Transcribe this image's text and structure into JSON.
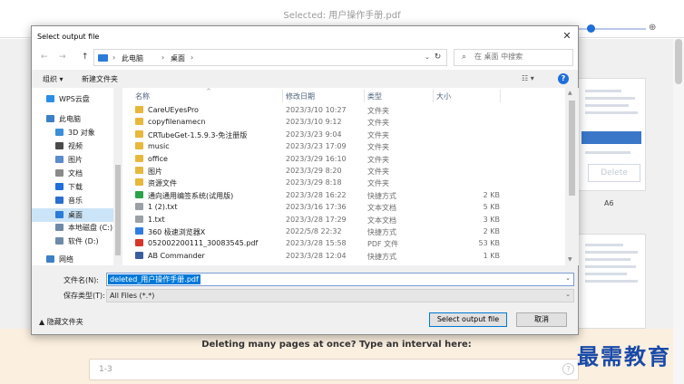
{
  "background": {
    "title": "Selected: 用户操作手册.pdf",
    "zoom_in_icon": "zoom-in-icon",
    "delete_label": "Delete",
    "page_label": "A6",
    "interval_prompt": "Deleting many pages at once? Type an interval here:",
    "interval_placeholder": "1-3",
    "help_glyph": "?",
    "watermark": "最需教育"
  },
  "dialog": {
    "title": "Select output file",
    "close_glyph": "✕",
    "nav": {
      "back": "←",
      "forward": "→",
      "up": "↑"
    },
    "breadcrumb": [
      "此电脑",
      "桌面"
    ],
    "breadcrumb_sep": "›",
    "search_placeholder": "在 桌面 中搜索",
    "toolbar": {
      "organize": "组织 ▾",
      "new_folder": "新建文件夹",
      "view": "☷ ▾"
    },
    "sidebar": [
      {
        "label": "WPS云盘",
        "icon": "cloud-icon",
        "color": "#2b8ee6"
      },
      {
        "label": "此电脑",
        "icon": "pc-icon",
        "color": "#3c7fc6"
      },
      {
        "label": "3D 对象",
        "icon": "cube-icon",
        "color": "#3a8fd8"
      },
      {
        "label": "视频",
        "icon": "video-icon",
        "color": "#4a4a4a"
      },
      {
        "label": "图片",
        "icon": "pictures-icon",
        "color": "#5b8ccc"
      },
      {
        "label": "文档",
        "icon": "documents-icon",
        "color": "#8a8a8a"
      },
      {
        "label": "下载",
        "icon": "download-icon",
        "color": "#1e6fd9"
      },
      {
        "label": "音乐",
        "icon": "music-icon",
        "color": "#2a6fd0"
      },
      {
        "label": "桌面",
        "icon": "desktop-icon",
        "color": "#2b7bd8",
        "selected": true
      },
      {
        "label": "本地磁盘 (C:)",
        "icon": "drive-icon",
        "color": "#6f8aa8"
      },
      {
        "label": "软件 (D:)",
        "icon": "drive-icon",
        "color": "#6f8aa8"
      },
      {
        "label": "网络",
        "icon": "network-icon",
        "color": "#3c7fc6"
      }
    ],
    "columns": {
      "name": "名称",
      "date": "修改日期",
      "type": "类型",
      "size": "大小"
    },
    "files": [
      {
        "name": "CareUEyesPro",
        "date": "2023/3/10 10:27",
        "type": "文件夹",
        "size": "",
        "icon": "folder-icon",
        "color": "#e8b83d"
      },
      {
        "name": "copyfilenamecn",
        "date": "2023/3/10 9:12",
        "type": "文件夹",
        "size": "",
        "icon": "folder-icon",
        "color": "#e8b83d"
      },
      {
        "name": "CRTubeGet-1.5.9.3-免注册版",
        "date": "2023/3/23 9:04",
        "type": "文件夹",
        "size": "",
        "icon": "folder-icon",
        "color": "#e8b83d"
      },
      {
        "name": "music",
        "date": "2023/3/23 17:09",
        "type": "文件夹",
        "size": "",
        "icon": "folder-icon",
        "color": "#e8b83d"
      },
      {
        "name": "office",
        "date": "2023/3/29 16:10",
        "type": "文件夹",
        "size": "",
        "icon": "folder-icon",
        "color": "#e8b83d"
      },
      {
        "name": "图片",
        "date": "2023/3/29 8:20",
        "type": "文件夹",
        "size": "",
        "icon": "folder-icon",
        "color": "#e8b83d"
      },
      {
        "name": "资源文件",
        "date": "2023/3/29 8:18",
        "type": "文件夹",
        "size": "",
        "icon": "folder-icon",
        "color": "#e8b83d"
      },
      {
        "name": "通向通用编签系统(试用版)",
        "date": "2023/3/28 16:22",
        "type": "快捷方式",
        "size": "2 KB",
        "icon": "shortcut-icon",
        "color": "#2aa34a"
      },
      {
        "name": "1 (2).txt",
        "date": "2023/3/16 17:36",
        "type": "文本文档",
        "size": "5 KB",
        "icon": "text-file-icon",
        "color": "#9aa0a6"
      },
      {
        "name": "1.txt",
        "date": "2023/3/28 17:29",
        "type": "文本文档",
        "size": "3 KB",
        "icon": "text-file-icon",
        "color": "#9aa0a6"
      },
      {
        "name": "360 极速浏览器X",
        "date": "2022/5/8 22:32",
        "type": "快捷方式",
        "size": "2 KB",
        "icon": "browser-icon",
        "color": "#2f7de1"
      },
      {
        "name": "052002200111_30083545.pdf",
        "date": "2023/3/28 15:58",
        "type": "PDF 文件",
        "size": "53 KB",
        "icon": "pdf-icon",
        "color": "#d9342b"
      },
      {
        "name": "AB Commander",
        "date": "2023/3/28 12:04",
        "type": "快捷方式",
        "size": "1 KB",
        "icon": "app-icon",
        "color": "#3b5f9e"
      }
    ],
    "filename_label": "文件名(N):",
    "filename_value": "deleted_用户操作手册.pdf",
    "filetype_label": "保存类型(T):",
    "filetype_value": "All Files (*.*)",
    "hide_folders": "▲ 隐藏文件夹",
    "select_button": "Select output file",
    "cancel_button": "取消"
  }
}
